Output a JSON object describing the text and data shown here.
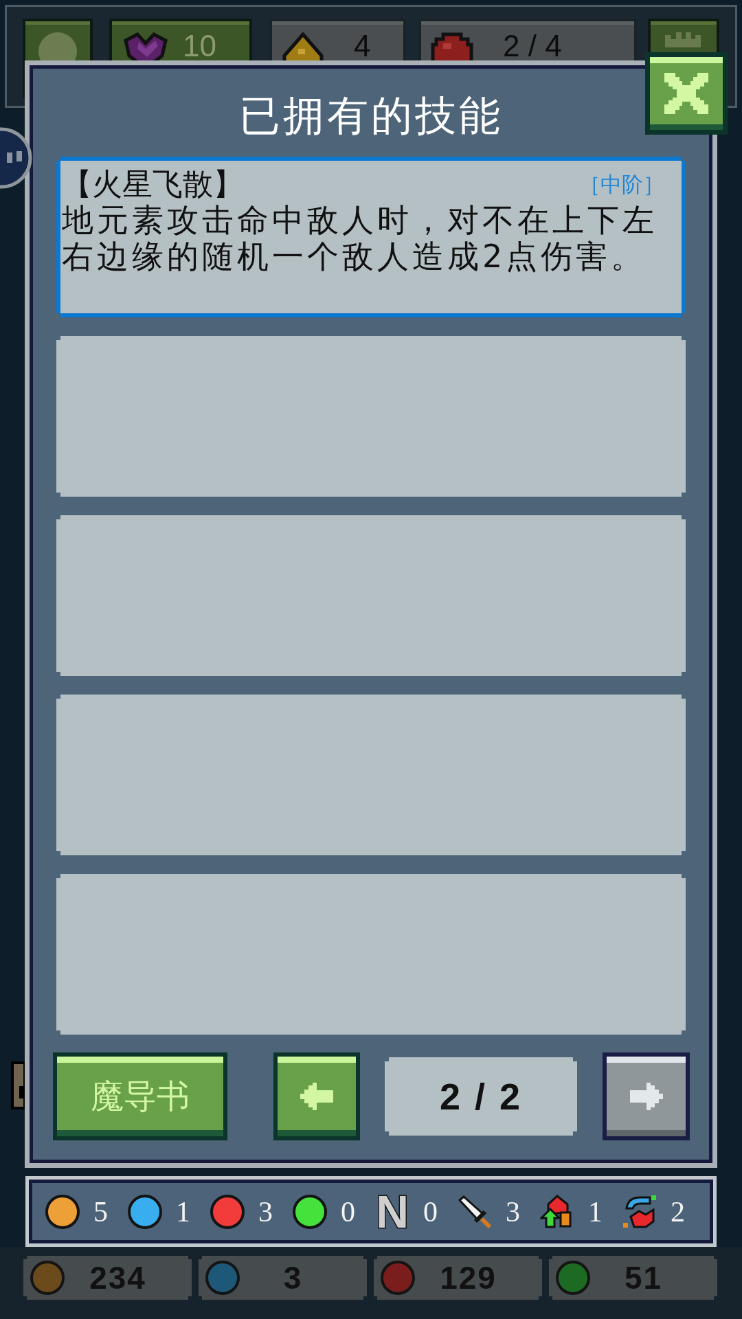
{
  "top_bar": {
    "slots": [
      {
        "kind": "button"
      },
      {
        "kind": "button",
        "text": "10"
      },
      {
        "kind": "stat",
        "text": "4"
      },
      {
        "kind": "stat",
        "text": "2 / 4"
      },
      {
        "kind": "button"
      }
    ]
  },
  "dialog": {
    "title": "已拥有的技能",
    "skills": [
      {
        "kind": "skill",
        "selected": true,
        "name": "【火星飞散】",
        "tier": "［中阶］",
        "description": "地元素攻击命中敌人时，对不在上下左右边缘的随机一个敌人造成2点伤害。"
      },
      {
        "kind": "empty",
        "selected": false
      },
      {
        "kind": "empty",
        "selected": false
      },
      {
        "kind": "empty",
        "selected": false
      },
      {
        "kind": "empty",
        "selected": false
      }
    ],
    "footer": [
      {
        "kind": "label",
        "label": "魔导书",
        "disabled": false
      },
      {
        "kind": "prev",
        "disabled": false
      },
      {
        "kind": "pager",
        "text": "2 / 2"
      },
      {
        "kind": "next",
        "disabled": true
      }
    ]
  },
  "inventory": {
    "items": [
      {
        "kind": "orb",
        "color": "#eea038",
        "count": "5"
      },
      {
        "kind": "orb",
        "color": "#38aef0",
        "count": "1"
      },
      {
        "kind": "orb",
        "color": "#f23c3c",
        "count": "3"
      },
      {
        "kind": "orb",
        "color": "#46e23c",
        "count": "0"
      },
      {
        "kind": "letter",
        "symbol": "N",
        "count": "0"
      },
      {
        "kind": "blade",
        "count": "3"
      },
      {
        "kind": "spire",
        "count": "1"
      },
      {
        "kind": "swirl",
        "count": "2"
      }
    ]
  },
  "resources": [
    {
      "color": "#6b4a1c",
      "value": "234"
    },
    {
      "color": "#1d5878",
      "value": "3"
    },
    {
      "color": "#7b1d1d",
      "value": "129"
    },
    {
      "color": "#1d6a22",
      "value": "51"
    }
  ]
}
